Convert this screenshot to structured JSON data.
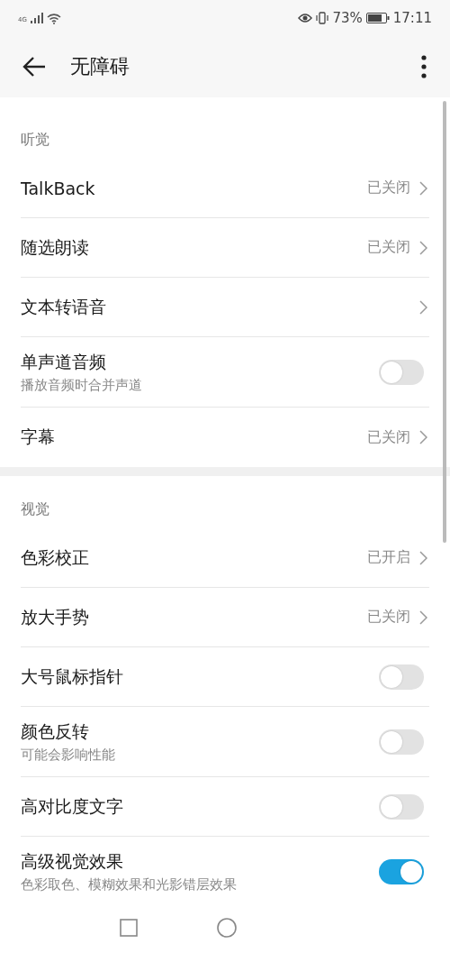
{
  "status_bar": {
    "network": "4G",
    "battery": "73%",
    "time": "17:11"
  },
  "header": {
    "title": "无障碍"
  },
  "sections": [
    {
      "title": "听觉",
      "items": [
        {
          "kind": "link",
          "label": "TalkBack",
          "value": "已关闭"
        },
        {
          "kind": "link",
          "label": "随选朗读",
          "value": "已关闭"
        },
        {
          "kind": "link",
          "label": "文本转语音"
        },
        {
          "kind": "toggle",
          "label": "单声道音频",
          "subtitle": "播放音频时合并声道",
          "on": false
        },
        {
          "kind": "link",
          "label": "字幕",
          "value": "已关闭"
        }
      ]
    },
    {
      "title": "视觉",
      "items": [
        {
          "kind": "link",
          "label": "色彩校正",
          "value": "已开启"
        },
        {
          "kind": "link",
          "label": "放大手势",
          "value": "已关闭"
        },
        {
          "kind": "toggle",
          "label": "大号鼠标指针",
          "on": false
        },
        {
          "kind": "toggle",
          "label": "颜色反转",
          "subtitle": "可能会影响性能",
          "on": false
        },
        {
          "kind": "toggle",
          "label": "高对比度文字",
          "on": false
        },
        {
          "kind": "toggle",
          "label": "高级视觉效果",
          "subtitle": "色彩取色、模糊效果和光影错层效果",
          "on": true
        }
      ]
    }
  ]
}
